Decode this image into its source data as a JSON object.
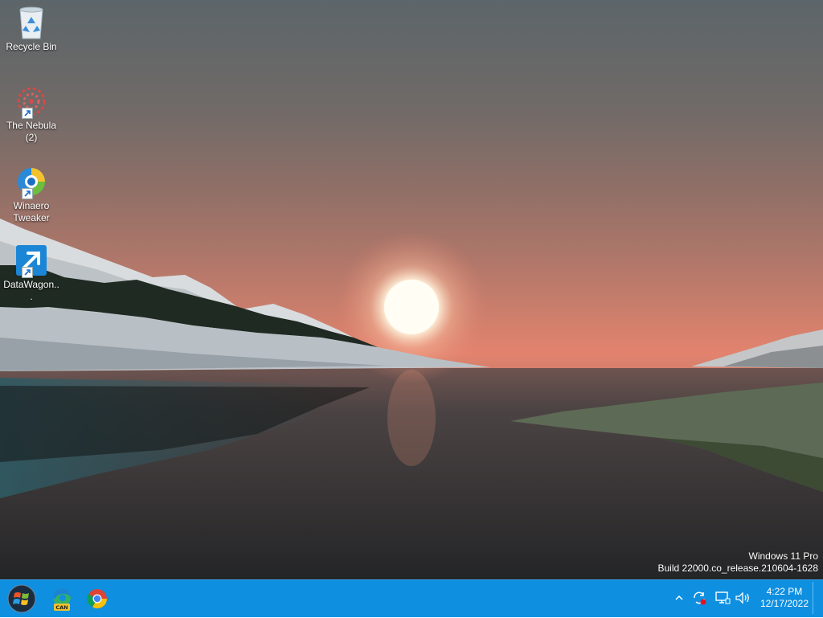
{
  "desktop": {
    "icons": [
      {
        "name": "recycle-bin",
        "label": "Recycle Bin"
      },
      {
        "name": "the-nebula",
        "label": "The Nebula (2)"
      },
      {
        "name": "winaero-tweaker",
        "label": "Winaero Tweaker"
      },
      {
        "name": "datawagon",
        "label": "DataWagon..."
      }
    ]
  },
  "watermark": {
    "edition": "Windows 11 Pro",
    "build": "Build 22000.co_release.210604-1628"
  },
  "taskbar": {
    "color": "#0e8fe0",
    "pinned": [
      {
        "name": "start-button",
        "icon": "windows-logo-icon"
      },
      {
        "name": "edge-can-button",
        "icon": "edge-canary-icon",
        "badge": "CAN"
      },
      {
        "name": "chrome-button",
        "icon": "chrome-icon"
      }
    ],
    "tray": {
      "icons": [
        "chevron-up-icon",
        "sync-icon",
        "network-icon",
        "volume-icon"
      ]
    },
    "clock": {
      "time": "4:22 PM",
      "date": "12/17/2022"
    }
  }
}
